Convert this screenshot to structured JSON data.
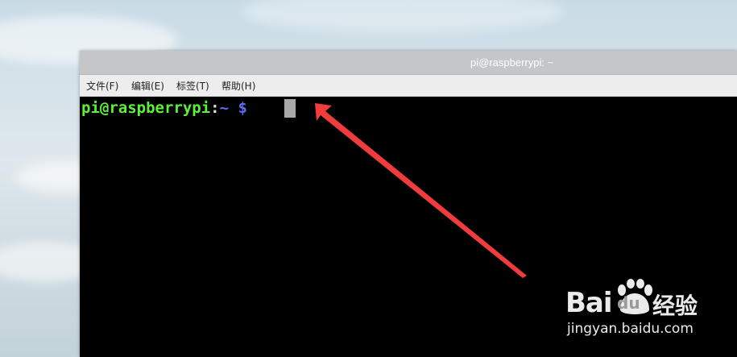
{
  "window": {
    "title": "pi@raspberrypi: ~"
  },
  "menu": {
    "items": [
      {
        "label": "文件(F)"
      },
      {
        "label": "编辑(E)"
      },
      {
        "label": "标签(T)"
      },
      {
        "label": "帮助(H)"
      }
    ]
  },
  "terminal": {
    "user_host": "pi@raspberrypi",
    "colon": ":",
    "path": "~",
    "dollar": "$",
    "colors": {
      "user_host": "#5cf03c",
      "path": "#5f6cf0",
      "background": "#000000",
      "cursor": "#a8a8a8"
    }
  },
  "annotation": {
    "arrow_color": "#f03c3c"
  },
  "watermark": {
    "brand_left": "Bai",
    "brand_paw": "du",
    "brand_right": "经验",
    "url": "jingyan.baidu.com"
  }
}
